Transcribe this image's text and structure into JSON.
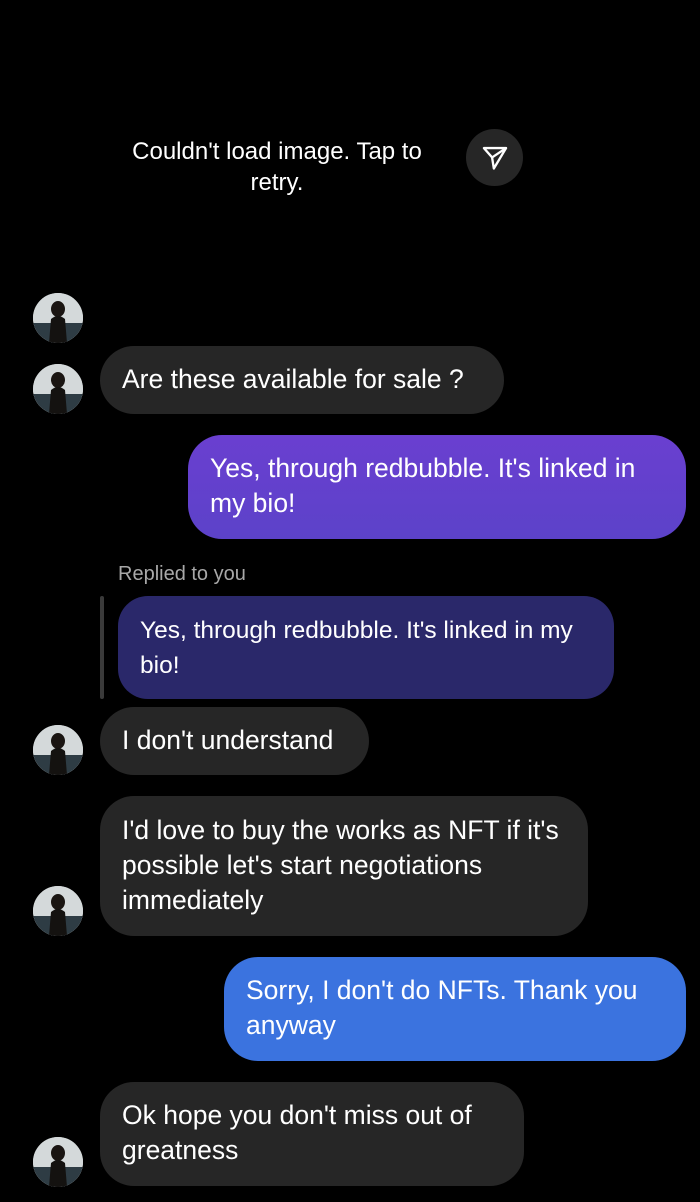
{
  "image_placeholder": {
    "error_text": "Couldn't load image. Tap to retry.",
    "share_icon": "paper-plane-icon"
  },
  "messages": [
    {
      "id": "m1",
      "direction": "incoming",
      "text": "Are these available for sale ?"
    },
    {
      "id": "m2",
      "direction": "outgoing",
      "text": "Yes, through redbubble. It's linked in my bio!"
    },
    {
      "id": "m3",
      "direction": "incoming",
      "reply_caption": "Replied to you",
      "quoted_text": "Yes, through redbubble. It's linked in my bio!",
      "text": "I don't understand"
    },
    {
      "id": "m4",
      "direction": "incoming",
      "text": "I'd love to buy the works as NFT if it's possible let's start negotiations immediately"
    },
    {
      "id": "m5",
      "direction": "outgoing",
      "text": "Sorry, I don't do NFTs. Thank you anyway"
    },
    {
      "id": "m6",
      "direction": "incoming",
      "text": "Ok hope you don't miss out of greatness"
    }
  ],
  "colors": {
    "background": "#000000",
    "incoming_bubble": "#262626",
    "outgoing_purple": "#6a3fd0",
    "outgoing_blue": "#3b73df",
    "quote_bubble": "#2a286a"
  }
}
